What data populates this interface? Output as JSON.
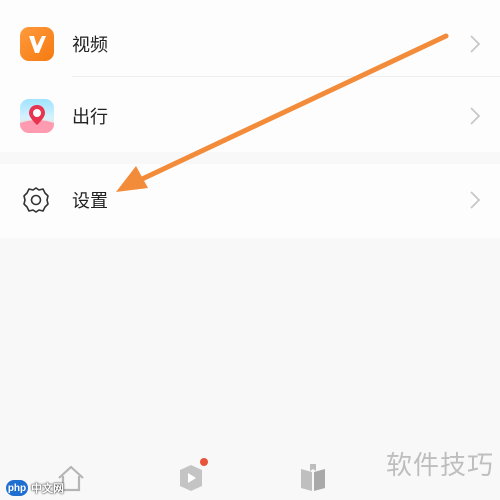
{
  "menu": {
    "items": [
      {
        "label": "视频",
        "icon": "video-icon"
      },
      {
        "label": "出行",
        "icon": "travel-icon"
      },
      {
        "label": "设置",
        "icon": "gear-icon"
      }
    ]
  },
  "tabbar": {
    "icons": [
      "home-icon",
      "video-play-icon",
      "book-icon"
    ]
  },
  "watermarks": {
    "left_logo": "php",
    "left_text": "中文网",
    "right_text": "软件技巧"
  },
  "colors": {
    "arrow": "#f28c3a",
    "video_icon": "#f57a10",
    "badge": "#e8553d"
  }
}
